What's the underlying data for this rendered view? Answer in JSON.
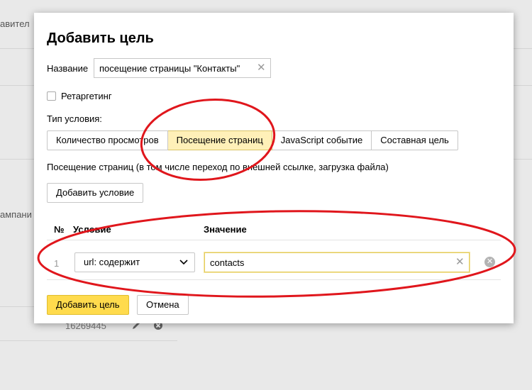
{
  "background": {
    "fragment_top": "авител",
    "fragment_mid": "ампани",
    "number_fragment": "16269445"
  },
  "modal": {
    "title": "Добавить цель",
    "name_label": "Название",
    "name_value": "посещение страницы \"Контакты\"",
    "retargeting_label": "Ретаргетинг",
    "retargeting_checked": false,
    "condition_type_label": "Тип условия:",
    "condition_types": [
      {
        "label": "Количество просмотров",
        "active": false
      },
      {
        "label": "Посещение страниц",
        "active": true
      },
      {
        "label": "JavaScript событие",
        "active": false
      },
      {
        "label": "Составная цель",
        "active": false
      }
    ],
    "description": "Посещение страниц (в том числе переход по внешней ссылке, загрузка файла)",
    "add_condition_label": "Добавить условие",
    "table": {
      "col_num": "№",
      "col_condition": "Условие",
      "col_value": "Значение",
      "rows": [
        {
          "num": "1",
          "condition": "url: содержит",
          "value": "contacts"
        }
      ]
    },
    "submit_label": "Добавить цель",
    "cancel_label": "Отмена"
  },
  "icons": {
    "clear": "close-icon",
    "select_arrow": "chevron-down-icon",
    "remove_row": "remove-circle-icon",
    "edit": "pencil-icon",
    "delete": "delete-circle-icon"
  },
  "colors": {
    "active_tab": "#fff0b8",
    "primary_button": "#ffdb4d",
    "annotation": "#e0161c"
  }
}
